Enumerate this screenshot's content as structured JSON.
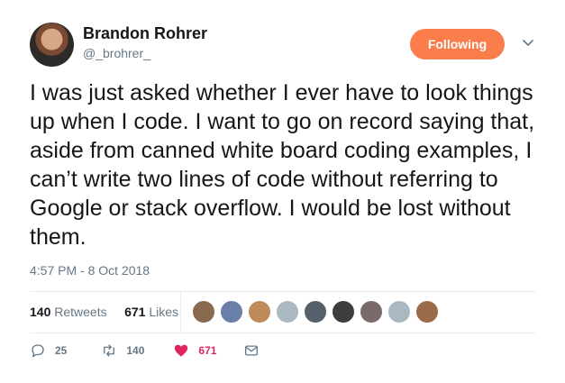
{
  "author": {
    "name": "Brandon Rohrer",
    "handle": "@_brohrer_"
  },
  "follow_button": {
    "label": "Following",
    "color": "#fa7d4b"
  },
  "tweet": {
    "text": "I was just asked whether I ever have to look things up when I code. I want to go on record saying that, aside from canned white board coding examples, I can’t write two lines of code without referring to Google or stack overflow. I would be lost without them.",
    "timestamp": "4:57 PM - 8 Oct 2018"
  },
  "stats": {
    "retweets_count": "140",
    "retweets_label": "Retweets",
    "likes_count": "671",
    "likes_label": "Likes"
  },
  "likers": [
    {
      "color": "#8a6a4f"
    },
    {
      "color": "#6a7fa8"
    },
    {
      "color": "#c08a5a"
    },
    {
      "color": "#aab8c2"
    },
    {
      "color": "#55606a"
    },
    {
      "color": "#3d3d3d"
    },
    {
      "color": "#7a6a6a"
    },
    {
      "color": "#aab8c2"
    },
    {
      "color": "#9a6a4a"
    }
  ],
  "actions": {
    "replies": "25",
    "retweets": "140",
    "likes": "671"
  },
  "colors": {
    "like_red": "#e0245e",
    "muted": "#657786"
  }
}
